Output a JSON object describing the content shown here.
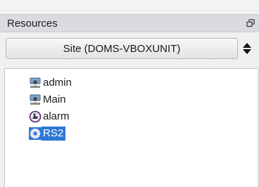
{
  "panel": {
    "title": "Resources",
    "float_icon": "float-window-icon"
  },
  "site_selector": {
    "value": "Site (DOMS-VBOXUNIT)",
    "spinner_icon": "up-down-arrows-icon"
  },
  "tree": {
    "items": [
      {
        "label": "admin",
        "icon": "computer-user-icon",
        "selected": false
      },
      {
        "label": "Main",
        "icon": "computer-user-icon",
        "selected": false
      },
      {
        "label": "alarm",
        "icon": "alarm-icon",
        "selected": false
      },
      {
        "label": "RS2",
        "icon": "gear-icon",
        "selected": true
      }
    ]
  },
  "colors": {
    "header_bg": "#d9dbdf",
    "selection": "#2f78d6",
    "tree_bg": "#ffffff"
  }
}
